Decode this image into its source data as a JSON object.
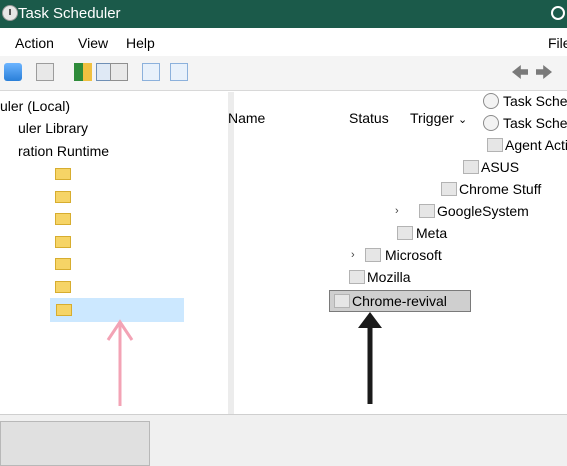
{
  "window": {
    "title": "Task Scheduler"
  },
  "menu": {
    "items": [
      "Action",
      "View",
      "Help"
    ],
    "right_fragment": "File"
  },
  "tree": {
    "items": [
      {
        "label": "uler (Local)"
      },
      {
        "label": "uler Library"
      },
      {
        "label": "ration Runtime"
      }
    ],
    "selected_placeholder": ""
  },
  "list_header": {
    "columns": [
      "Name",
      "Status",
      "Trigger"
    ]
  },
  "popup": {
    "items": [
      {
        "label": "Task Sche",
        "icon": "clock-icon"
      },
      {
        "label": "Task Sche",
        "icon": "clock-icon"
      },
      {
        "label": "Agent Acti",
        "icon": "folder-icon"
      },
      {
        "label": "ASUS",
        "icon": "folder-icon"
      },
      {
        "label": "Chrome Stuff",
        "icon": "folder-icon"
      },
      {
        "label": "GoogleSystem",
        "icon": "folder-icon",
        "expandable": true
      },
      {
        "label": "Meta",
        "icon": "folder-icon"
      },
      {
        "label": "Microsoft",
        "icon": "folder-icon",
        "expandable": true
      },
      {
        "label": "Mozilla",
        "icon": "folder-icon"
      },
      {
        "label": "Chrome-revival",
        "icon": "folder-icon",
        "editing": true
      }
    ]
  },
  "colors": {
    "titlebar": "#1b5a4a",
    "selection": "#cce8ff",
    "annotation_pink": "#f3a3b5",
    "annotation_dark": "#1a1a1a"
  }
}
